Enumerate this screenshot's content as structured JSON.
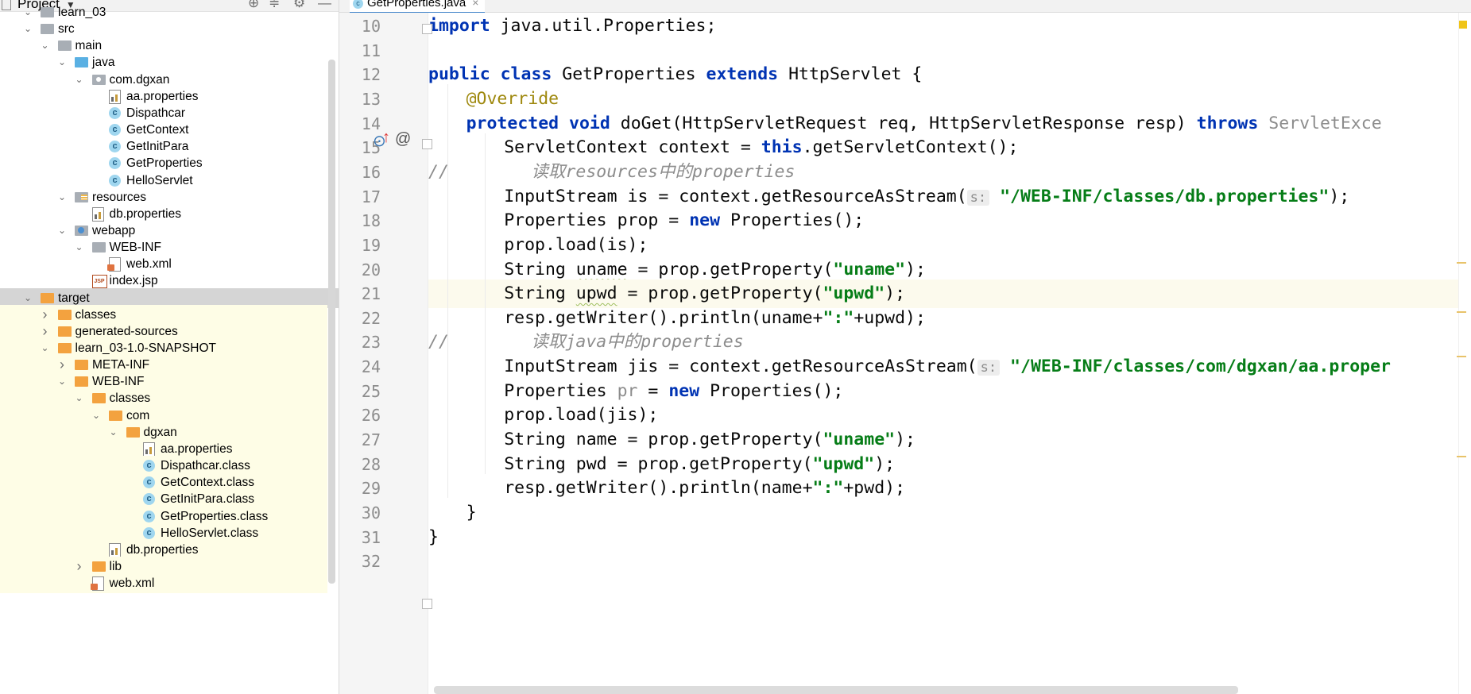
{
  "project_panel": {
    "title": "Project",
    "tree": [
      {
        "label": "learn_03",
        "depth": 1,
        "expanded": true,
        "icon": "folder-gray"
      },
      {
        "label": "src",
        "depth": 1,
        "expanded": true,
        "icon": "folder-gray"
      },
      {
        "label": "main",
        "depth": 2,
        "expanded": true,
        "icon": "folder-gray"
      },
      {
        "label": "java",
        "depth": 3,
        "expanded": true,
        "icon": "folder-blue"
      },
      {
        "label": "com.dgxan",
        "depth": 4,
        "expanded": true,
        "icon": "pkg"
      },
      {
        "label": "aa.properties",
        "depth": 5,
        "icon": "props"
      },
      {
        "label": "Dispathcar",
        "depth": 5,
        "icon": "cls"
      },
      {
        "label": "GetContext",
        "depth": 5,
        "icon": "cls"
      },
      {
        "label": "GetInitPara",
        "depth": 5,
        "icon": "cls"
      },
      {
        "label": "GetProperties",
        "depth": 5,
        "icon": "cls"
      },
      {
        "label": "HelloServlet",
        "depth": 5,
        "icon": "cls"
      },
      {
        "label": "resources",
        "depth": 3,
        "expanded": true,
        "icon": "folder-res"
      },
      {
        "label": "db.properties",
        "depth": 4,
        "icon": "props"
      },
      {
        "label": "webapp",
        "depth": 3,
        "expanded": true,
        "icon": "folder-web"
      },
      {
        "label": "WEB-INF",
        "depth": 4,
        "expanded": true,
        "icon": "folder-gray"
      },
      {
        "label": "web.xml",
        "depth": 5,
        "icon": "xml"
      },
      {
        "label": "index.jsp",
        "depth": 4,
        "icon": "jsp"
      },
      {
        "label": "target",
        "depth": 1,
        "expanded": true,
        "icon": "folder-orange",
        "selected": true
      },
      {
        "label": "classes",
        "depth": 2,
        "expanded": false,
        "icon": "folder-orange",
        "hl": true
      },
      {
        "label": "generated-sources",
        "depth": 2,
        "expanded": false,
        "icon": "folder-orange",
        "hl": true
      },
      {
        "label": "learn_03-1.0-SNAPSHOT",
        "depth": 2,
        "expanded": true,
        "icon": "folder-orange",
        "hl": true
      },
      {
        "label": "META-INF",
        "depth": 3,
        "expanded": false,
        "icon": "folder-orange",
        "hl": true
      },
      {
        "label": "WEB-INF",
        "depth": 3,
        "expanded": true,
        "icon": "folder-orange",
        "hl": true
      },
      {
        "label": "classes",
        "depth": 4,
        "expanded": true,
        "icon": "folder-orange",
        "hl": true
      },
      {
        "label": "com",
        "depth": 5,
        "expanded": true,
        "icon": "folder-orange",
        "hl": true
      },
      {
        "label": "dgxan",
        "depth": 6,
        "expanded": true,
        "icon": "folder-orange",
        "hl": true
      },
      {
        "label": "aa.properties",
        "depth": 7,
        "icon": "props",
        "hl": true
      },
      {
        "label": "Dispathcar.class",
        "depth": 7,
        "icon": "cls",
        "hl": true
      },
      {
        "label": "GetContext.class",
        "depth": 7,
        "icon": "cls",
        "hl": true
      },
      {
        "label": "GetInitPara.class",
        "depth": 7,
        "icon": "cls",
        "hl": true
      },
      {
        "label": "GetProperties.class",
        "depth": 7,
        "icon": "cls",
        "hl": true
      },
      {
        "label": "HelloServlet.class",
        "depth": 7,
        "icon": "cls",
        "hl": true
      },
      {
        "label": "db.properties",
        "depth": 5,
        "icon": "props",
        "hl": true
      },
      {
        "label": "lib",
        "depth": 4,
        "expanded": false,
        "icon": "folder-orange",
        "hl": true
      },
      {
        "label": "web.xml",
        "depth": 4,
        "icon": "xml",
        "hl": true
      }
    ]
  },
  "editor": {
    "tab_label": "GetProperties.java",
    "current_line": 21,
    "lines": [
      {
        "n": "10",
        "indent": 0,
        "tokens": [
          [
            "kw",
            "import"
          ],
          [
            "t",
            " java.util.Properties;"
          ]
        ]
      },
      {
        "n": "11",
        "indent": 0,
        "tokens": []
      },
      {
        "n": "12",
        "indent": 0,
        "tokens": [
          [
            "kw",
            "public class"
          ],
          [
            "t",
            " GetProperties "
          ],
          [
            "kw",
            "extends"
          ],
          [
            "t",
            " HttpServlet {"
          ]
        ]
      },
      {
        "n": "13",
        "indent": 1,
        "tokens": [
          [
            "ann",
            "@Override"
          ]
        ]
      },
      {
        "n": "14",
        "indent": 1,
        "tokens": [
          [
            "kw",
            "protected void"
          ],
          [
            "t",
            " doGet(HttpServletRequest req, HttpServletResponse resp) "
          ],
          [
            "kw",
            "throws"
          ],
          [
            "dim",
            " ServletExce"
          ]
        ]
      },
      {
        "n": "15",
        "indent": 2,
        "tokens": [
          [
            "t",
            "ServletContext context = "
          ],
          [
            "kw",
            "this"
          ],
          [
            "t",
            ".getServletContext();"
          ]
        ]
      },
      {
        "n": "16",
        "indent": 0,
        "tokens": [
          [
            "cm",
            "//        读取resources中的properties"
          ]
        ]
      },
      {
        "n": "17",
        "indent": 2,
        "tokens": [
          [
            "t",
            "InputStream is = context.getResourceAsStream("
          ],
          [
            "hint",
            "s:"
          ],
          [
            "str",
            " \"/WEB-INF/classes/db.properties\""
          ],
          [
            "t",
            ");"
          ]
        ]
      },
      {
        "n": "18",
        "indent": 2,
        "tokens": [
          [
            "t",
            "Properties prop = "
          ],
          [
            "kw",
            "new"
          ],
          [
            "t",
            " Properties();"
          ]
        ]
      },
      {
        "n": "19",
        "indent": 2,
        "tokens": [
          [
            "t",
            "prop.load(is);"
          ]
        ]
      },
      {
        "n": "20",
        "indent": 2,
        "tokens": [
          [
            "t",
            "String "
          ],
          [
            "warn",
            "uname"
          ],
          [
            "t",
            " = prop.getProperty("
          ],
          [
            "str",
            "\"uname\""
          ],
          [
            "t",
            ");"
          ]
        ]
      },
      {
        "n": "21",
        "indent": 2,
        "tokens": [
          [
            "t",
            "String "
          ],
          [
            "warn",
            "upwd"
          ],
          [
            "t",
            " = prop.getProperty("
          ],
          [
            "str",
            "\"upwd\""
          ],
          [
            "t",
            ");"
          ]
        ]
      },
      {
        "n": "22",
        "indent": 2,
        "tokens": [
          [
            "t",
            "resp.getWriter().println(uname+"
          ],
          [
            "str",
            "\":\""
          ],
          [
            "t",
            "+upwd);"
          ]
        ]
      },
      {
        "n": "23",
        "indent": 0,
        "tokens": [
          [
            "cm",
            "//        读取java中的properties"
          ]
        ]
      },
      {
        "n": "24",
        "indent": 2,
        "tokens": [
          [
            "t",
            "InputStream jis = context.getResourceAsStream("
          ],
          [
            "hint",
            "s:"
          ],
          [
            "str",
            " \"/WEB-INF/classes/com/dgxan/aa.proper"
          ]
        ]
      },
      {
        "n": "25",
        "indent": 2,
        "tokens": [
          [
            "t",
            "Properties "
          ],
          [
            "dim",
            "pr"
          ],
          [
            "t",
            " = "
          ],
          [
            "kw",
            "new"
          ],
          [
            "t",
            " Properties();"
          ]
        ]
      },
      {
        "n": "26",
        "indent": 2,
        "tokens": [
          [
            "t",
            "prop.load(jis);"
          ]
        ]
      },
      {
        "n": "27",
        "indent": 2,
        "tokens": [
          [
            "t",
            "String name = prop.getProperty("
          ],
          [
            "str",
            "\"uname\""
          ],
          [
            "t",
            ");"
          ]
        ]
      },
      {
        "n": "28",
        "indent": 2,
        "tokens": [
          [
            "t",
            "String pwd = prop.getProperty("
          ],
          [
            "str",
            "\"upwd\""
          ],
          [
            "t",
            ");"
          ]
        ]
      },
      {
        "n": "29",
        "indent": 2,
        "tokens": [
          [
            "t",
            "resp.getWriter().println(name+"
          ],
          [
            "str",
            "\":\""
          ],
          [
            "t",
            "+pwd);"
          ]
        ]
      },
      {
        "n": "30",
        "indent": 1,
        "tokens": [
          [
            "t",
            "}"
          ]
        ]
      },
      {
        "n": "31",
        "indent": 0,
        "tokens": [
          [
            "t",
            "}"
          ]
        ]
      },
      {
        "n": "32",
        "indent": 0,
        "tokens": []
      }
    ]
  },
  "icons": {
    "locate": "crosshair-icon",
    "collapse": "collapse-all-icon",
    "settings": "gear-icon",
    "hide": "minimize-icon",
    "override": "override-method-icon",
    "at": "annotation-icon"
  },
  "colors": {
    "keyword": "#0033b3",
    "string": "#067d17",
    "annotation": "#9e880d",
    "comment": "#8c8c8c",
    "excluded_highlight": "#fefde6",
    "selection": "#d5d5d5"
  }
}
